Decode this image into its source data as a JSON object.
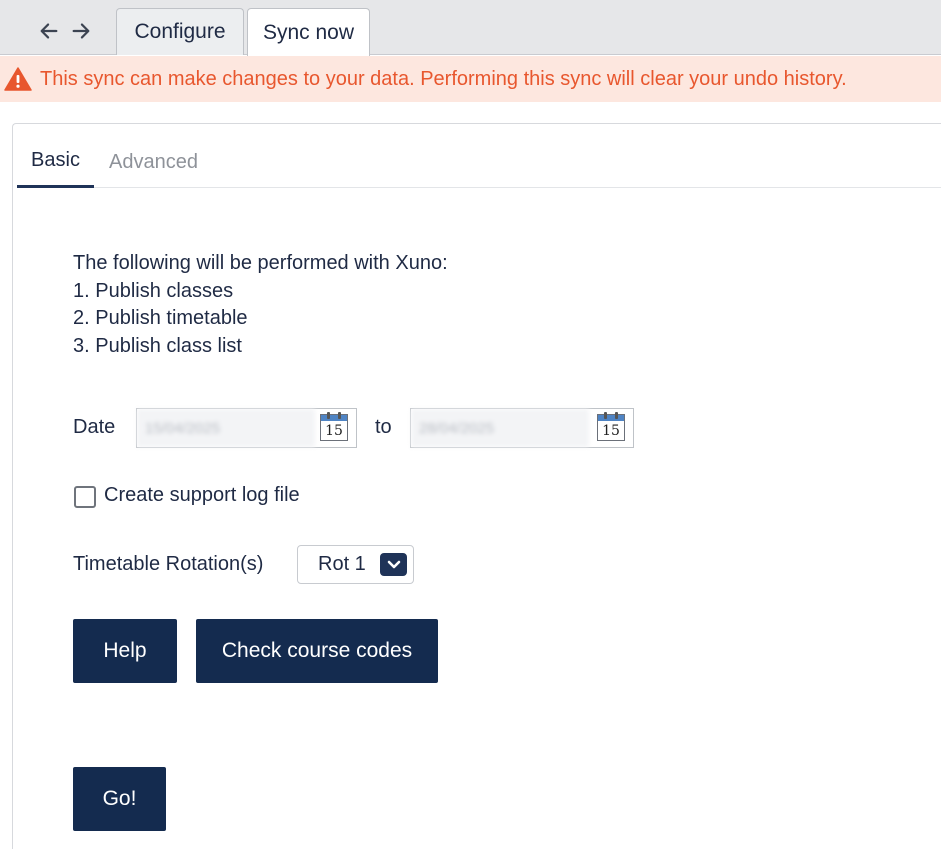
{
  "header": {
    "nav": {
      "back_icon": "arrow-left-icon",
      "forward_icon": "arrow-right-icon"
    },
    "tabs": [
      {
        "label": "Configure",
        "active": false
      },
      {
        "label": "Sync now",
        "active": true
      }
    ]
  },
  "warning": {
    "icon": "warning-triangle-icon",
    "text": "This sync can make changes to your data. Performing this sync will clear your undo history.",
    "color": "#e8572e",
    "background": "#fde7df"
  },
  "subtabs": [
    {
      "label": "Basic",
      "active": true
    },
    {
      "label": "Advanced",
      "active": false
    }
  ],
  "intro": {
    "heading": "The following will be performed with Xuno:",
    "steps": [
      "1.  Publish classes",
      "2.  Publish timetable",
      "3.  Publish class list"
    ]
  },
  "date_range": {
    "label": "Date",
    "from_value": "15/04/2025",
    "to_label": "to",
    "to_value": "28/04/2025",
    "calendar_icon": "calendar-icon",
    "calendar_day": "15"
  },
  "support_log": {
    "label": "Create support log file",
    "checked": false
  },
  "rotation": {
    "label": "Timetable Rotation(s)",
    "selected": "Rot 1",
    "icon": "chevron-down-icon"
  },
  "buttons": {
    "help": "Help",
    "check_codes": "Check course codes",
    "go": "Go!"
  },
  "colors": {
    "primary": "#142b4f",
    "text": "#1f2a44"
  }
}
